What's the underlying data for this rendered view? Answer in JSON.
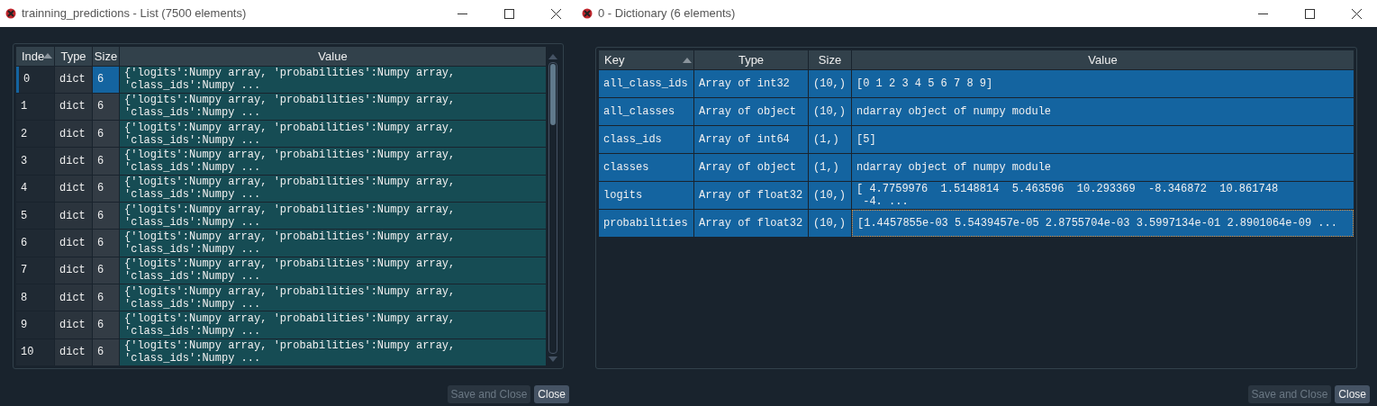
{
  "windows": [
    {
      "title": "trainning_predictions - List (7500 elements)",
      "kind": "list",
      "columns": [
        {
          "label": "Inde",
          "sorted": true
        },
        {
          "label": "Type",
          "sorted": false
        },
        {
          "label": "Size",
          "sorted": false
        },
        {
          "label": "Value",
          "sorted": false
        }
      ],
      "rows": [
        {
          "cells": [
            "0",
            "dict",
            "6",
            "{'logits':Numpy array, 'probabilities':Numpy array,\n'class_ids':Numpy ..."
          ],
          "selected": true,
          "focused": false
        },
        {
          "cells": [
            "1",
            "dict",
            "6",
            "{'logits':Numpy array, 'probabilities':Numpy array,\n'class_ids':Numpy ..."
          ],
          "selected": false,
          "focused": false
        },
        {
          "cells": [
            "2",
            "dict",
            "6",
            "{'logits':Numpy array, 'probabilities':Numpy array,\n'class_ids':Numpy ..."
          ],
          "selected": false,
          "focused": false
        },
        {
          "cells": [
            "3",
            "dict",
            "6",
            "{'logits':Numpy array, 'probabilities':Numpy array,\n'class_ids':Numpy ..."
          ],
          "selected": false,
          "focused": false
        },
        {
          "cells": [
            "4",
            "dict",
            "6",
            "{'logits':Numpy array, 'probabilities':Numpy array,\n'class_ids':Numpy ..."
          ],
          "selected": false,
          "focused": false
        },
        {
          "cells": [
            "5",
            "dict",
            "6",
            "{'logits':Numpy array, 'probabilities':Numpy array,\n'class_ids':Numpy ..."
          ],
          "selected": false,
          "focused": false
        },
        {
          "cells": [
            "6",
            "dict",
            "6",
            "{'logits':Numpy array, 'probabilities':Numpy array,\n'class_ids':Numpy ..."
          ],
          "selected": false,
          "focused": false
        },
        {
          "cells": [
            "7",
            "dict",
            "6",
            "{'logits':Numpy array, 'probabilities':Numpy array,\n'class_ids':Numpy ..."
          ],
          "selected": false,
          "focused": false
        },
        {
          "cells": [
            "8",
            "dict",
            "6",
            "{'logits':Numpy array, 'probabilities':Numpy array,\n'class_ids':Numpy ..."
          ],
          "selected": false,
          "focused": false
        },
        {
          "cells": [
            "9",
            "dict",
            "6",
            "{'logits':Numpy array, 'probabilities':Numpy array,\n'class_ids':Numpy ..."
          ],
          "selected": false,
          "focused": false
        },
        {
          "cells": [
            "10",
            "dict",
            "6",
            "{'logits':Numpy array, 'probabilities':Numpy array,\n'class_ids':Numpy ..."
          ],
          "selected": false,
          "focused": false
        }
      ],
      "buttons": [
        {
          "label": "Save and Close",
          "disabled": true
        },
        {
          "label": "Close",
          "disabled": false
        }
      ]
    },
    {
      "title": "0 - Dictionary (6 elements)",
      "kind": "dict",
      "columns": [
        {
          "label": "Key",
          "sorted": true
        },
        {
          "label": "Type",
          "sorted": false
        },
        {
          "label": "Size",
          "sorted": false
        },
        {
          "label": "Value",
          "sorted": false
        }
      ],
      "rows": [
        {
          "cells": [
            "all_class_ids",
            "Array of int32",
            "(10,)",
            "[0 1 2 3 4 5 6 7 8 9]"
          ],
          "selected": true,
          "focused": false
        },
        {
          "cells": [
            "all_classes",
            "Array of object",
            "(10,)",
            "ndarray object of numpy module"
          ],
          "selected": true,
          "focused": false
        },
        {
          "cells": [
            "class_ids",
            "Array of int64",
            "(1,)",
            "[5]"
          ],
          "selected": true,
          "focused": false
        },
        {
          "cells": [
            "classes",
            "Array of object",
            "(1,)",
            "ndarray object of numpy module"
          ],
          "selected": true,
          "focused": false
        },
        {
          "cells": [
            "logits",
            "Array of float32",
            "(10,)",
            "[ 4.7759976  1.5148814  5.463596  10.293369  -8.346872  10.861748\n -4. ..."
          ],
          "selected": true,
          "focused": false
        },
        {
          "cells": [
            "probabilities",
            "Array of float32",
            "(10,)",
            "[1.4457855e-03 5.5439457e-05 2.8755704e-03 3.5997134e-01 2.8901064e-09 ..."
          ],
          "selected": true,
          "focused": true
        }
      ],
      "buttons": [
        {
          "label": "Save and Close",
          "disabled": true
        },
        {
          "label": "Close",
          "disabled": false
        }
      ]
    }
  ]
}
